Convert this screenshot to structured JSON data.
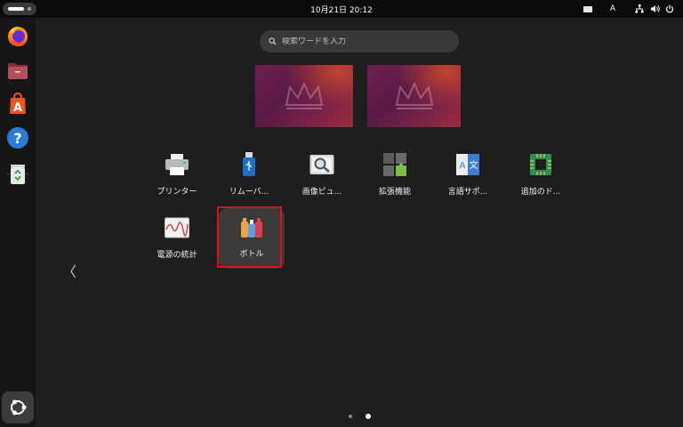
{
  "topbar": {
    "clock": "10月21日  20:12",
    "input_method": "A"
  },
  "dock": {
    "items": [
      "firefox-icon",
      "files-icon",
      "app-center-icon",
      "help-icon",
      "trash-icon"
    ],
    "show_apps": "ubuntu-show-apps-icon"
  },
  "search": {
    "placeholder": "検索ワードを入力"
  },
  "apps": [
    {
      "label": "プリンター",
      "icon": "printer-icon"
    },
    {
      "label": "リムーバ...",
      "icon": "usb-icon"
    },
    {
      "label": "画像ビュ...",
      "icon": "image-viewer-icon"
    },
    {
      "label": "拡張機能",
      "icon": "extensions-icon"
    },
    {
      "label": "言語サポ...",
      "icon": "language-icon"
    },
    {
      "label": "追加のド...",
      "icon": "chip-icon"
    },
    {
      "label": "電源の統計",
      "icon": "power-stats-icon"
    },
    {
      "label": "ボトル",
      "icon": "bottles-icon"
    }
  ],
  "pager": {
    "prev_symbol": "〈",
    "pages": 2,
    "current": 2
  },
  "colors": {
    "highlight": "#e0101a",
    "background": "#1e1e1e",
    "topbar": "#0b0b0b"
  }
}
